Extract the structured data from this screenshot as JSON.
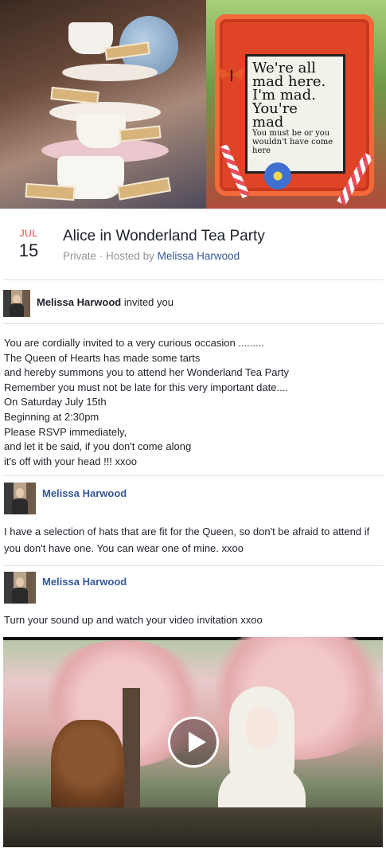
{
  "cover": {
    "sign_lines": [
      "We're all",
      "mad here.",
      "I'm mad.",
      "You're",
      "mad"
    ],
    "sign_small": "You must be or you wouldn't have come here"
  },
  "event": {
    "month": "JUL",
    "day": "15",
    "title": "Alice in Wonderland Tea Party",
    "privacy": "Private",
    "hosted_by_prefix": "· Hosted by",
    "host": "Melissa Harwood"
  },
  "invite": {
    "name": "Melissa Harwood",
    "action": "invited you"
  },
  "description": {
    "lines": [
      "You are cordially invited to a very curious occasion .........",
      "The Queen of Hearts has made some tarts",
      "and hereby summons you to attend her Wonderland Tea Party",
      "Remember you must not be late for this very important date....",
      "On Saturday July 15th",
      "Beginning at 2:30pm",
      "Please RSVP immediately,",
      "and let it be said, if you don't come along",
      "it's off with your head !!! xxoo"
    ]
  },
  "posts": [
    {
      "author": "Melissa Harwood",
      "text": "I have a selection of hats that are fit for the Queen, so don't be afraid to attend if you don't have one. You can wear one of mine. xxoo"
    },
    {
      "author": "Melissa Harwood",
      "text": "Turn your sound up and watch your video invitation xxoo"
    }
  ],
  "video": {
    "play_icon": "play-icon"
  },
  "colors": {
    "accent_link": "#365899",
    "month_red": "#e0454a",
    "meta_gray": "#90949c",
    "divider": "#dddfe2"
  }
}
